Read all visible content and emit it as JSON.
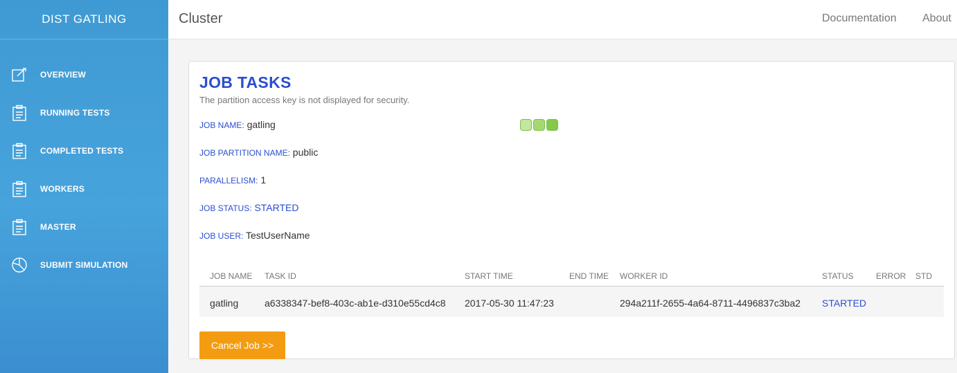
{
  "brand": "DIST GATLING",
  "sidebar": {
    "items": [
      {
        "label": "OVERVIEW",
        "icon": "edit-icon"
      },
      {
        "label": "RUNNING TESTS",
        "icon": "clipboard-icon"
      },
      {
        "label": "COMPLETED TESTS",
        "icon": "clipboard-icon"
      },
      {
        "label": "WORKERS",
        "icon": "clipboard-icon"
      },
      {
        "label": "MASTER",
        "icon": "clipboard-icon"
      },
      {
        "label": "SUBMIT SIMULATION",
        "icon": "pie-chart-icon"
      }
    ]
  },
  "header": {
    "title": "Cluster",
    "links": {
      "documentation": "Documentation",
      "about": "About"
    }
  },
  "card": {
    "title": "JOB TASKS",
    "subtitle": "The partition access key is not displayed for security.",
    "fields": {
      "job_name": {
        "label": "JOB NAME:",
        "value": "gatling"
      },
      "partition": {
        "label": "JOB PARTITION NAME:",
        "value": "public"
      },
      "parallelism": {
        "label": "PARALLELISM:",
        "value": "1"
      },
      "status": {
        "label": "JOB STATUS:",
        "value": "STARTED"
      },
      "user": {
        "label": "JOB USER:",
        "value": "TestUserName"
      }
    },
    "status_dots_colors": [
      "#c3e6a0",
      "#a5d873",
      "#84c94a"
    ],
    "cancel_label": "Cancel Job >>"
  },
  "table": {
    "headers": {
      "job_name": "JOB NAME",
      "task_id": "TASK ID",
      "start_time": "START TIME",
      "end_time": "END TIME",
      "worker_id": "WORKER ID",
      "status": "STATUS",
      "error": "ERROR",
      "std": "STD"
    },
    "rows": [
      {
        "job_name": "gatling",
        "task_id": "a6338347-bef8-403c-ab1e-d310e55cd4c8",
        "start_time": "2017-05-30 11:47:23",
        "end_time": "",
        "worker_id": "294a211f-2655-4a64-8711-4496837c3ba2",
        "status": "STARTED",
        "error": "",
        "std": ""
      }
    ]
  },
  "colors": {
    "accent": "#2b4fd0",
    "sidebar": "#47a3dc",
    "button": "#f39c12"
  }
}
